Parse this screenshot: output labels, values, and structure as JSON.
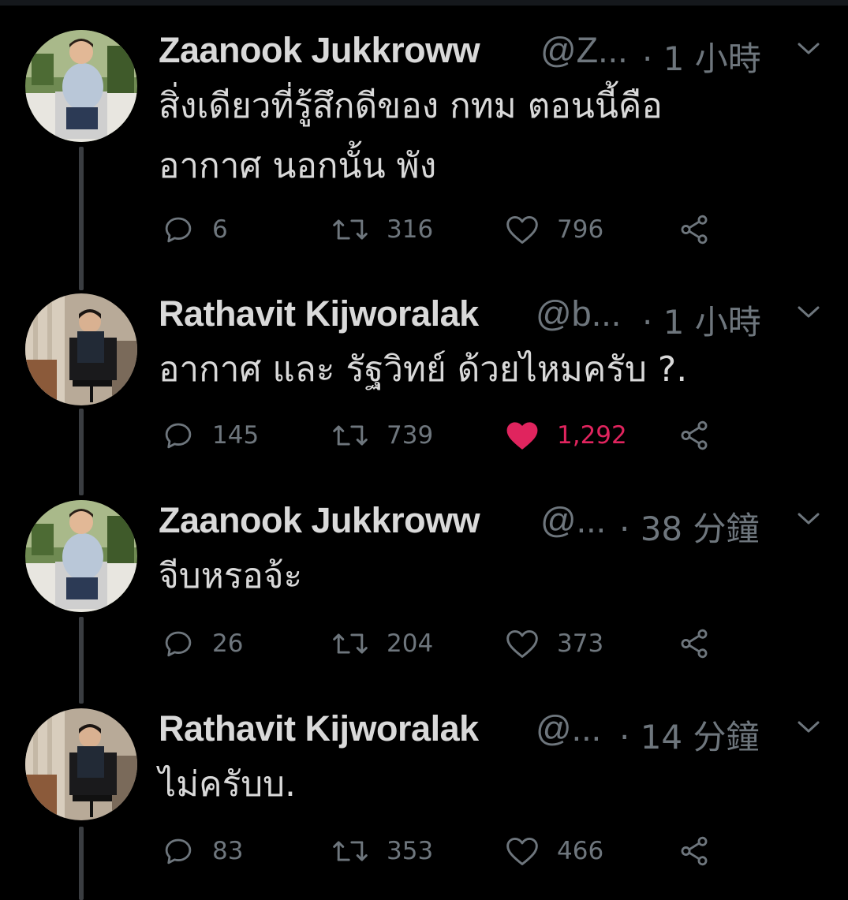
{
  "colors": {
    "background": "#000000",
    "primary_text": "#d9d9d9",
    "secondary_text": "#6e767d",
    "like_active": "#e0245e",
    "thread_line": "#3a3d41"
  },
  "icons": {
    "reply": "reply-icon",
    "retweet": "retweet-icon",
    "like": "heart-icon",
    "share": "share-icon",
    "menu": "chevron-down-icon"
  },
  "tweets": [
    {
      "name": "Zaanook Jukkroww",
      "handle": "@Z...",
      "time": "· 1 小時",
      "text_lines": [
        "สิ่งเดียวที่รู้สึกดีของ กทม ตอนนี้คือ",
        "อากาศ นอกนั้น พัง"
      ],
      "replies": "6",
      "retweets": "316",
      "likes": "796",
      "liked": false
    },
    {
      "name": "Rathavit Kijworalak",
      "handle": "@b...",
      "time": "· 1 小時",
      "text_lines": [
        "อากาศ และ รัฐวิทย์ ด้วยไหมครับ ?."
      ],
      "replies": "145",
      "retweets": "739",
      "likes": "1,292",
      "liked": true
    },
    {
      "name": "Zaanook Jukkroww",
      "handle": "@...",
      "time": "· 38 分鐘",
      "text_lines": [
        "จีบหรอจ้ะ"
      ],
      "replies": "26",
      "retweets": "204",
      "likes": "373",
      "liked": false
    },
    {
      "name": "Rathavit Kijworalak",
      "handle": "@...",
      "time": "· 14 分鐘",
      "text_lines": [
        "ไม่ครับบ."
      ],
      "replies": "83",
      "retweets": "353",
      "likes": "466",
      "liked": false
    }
  ]
}
